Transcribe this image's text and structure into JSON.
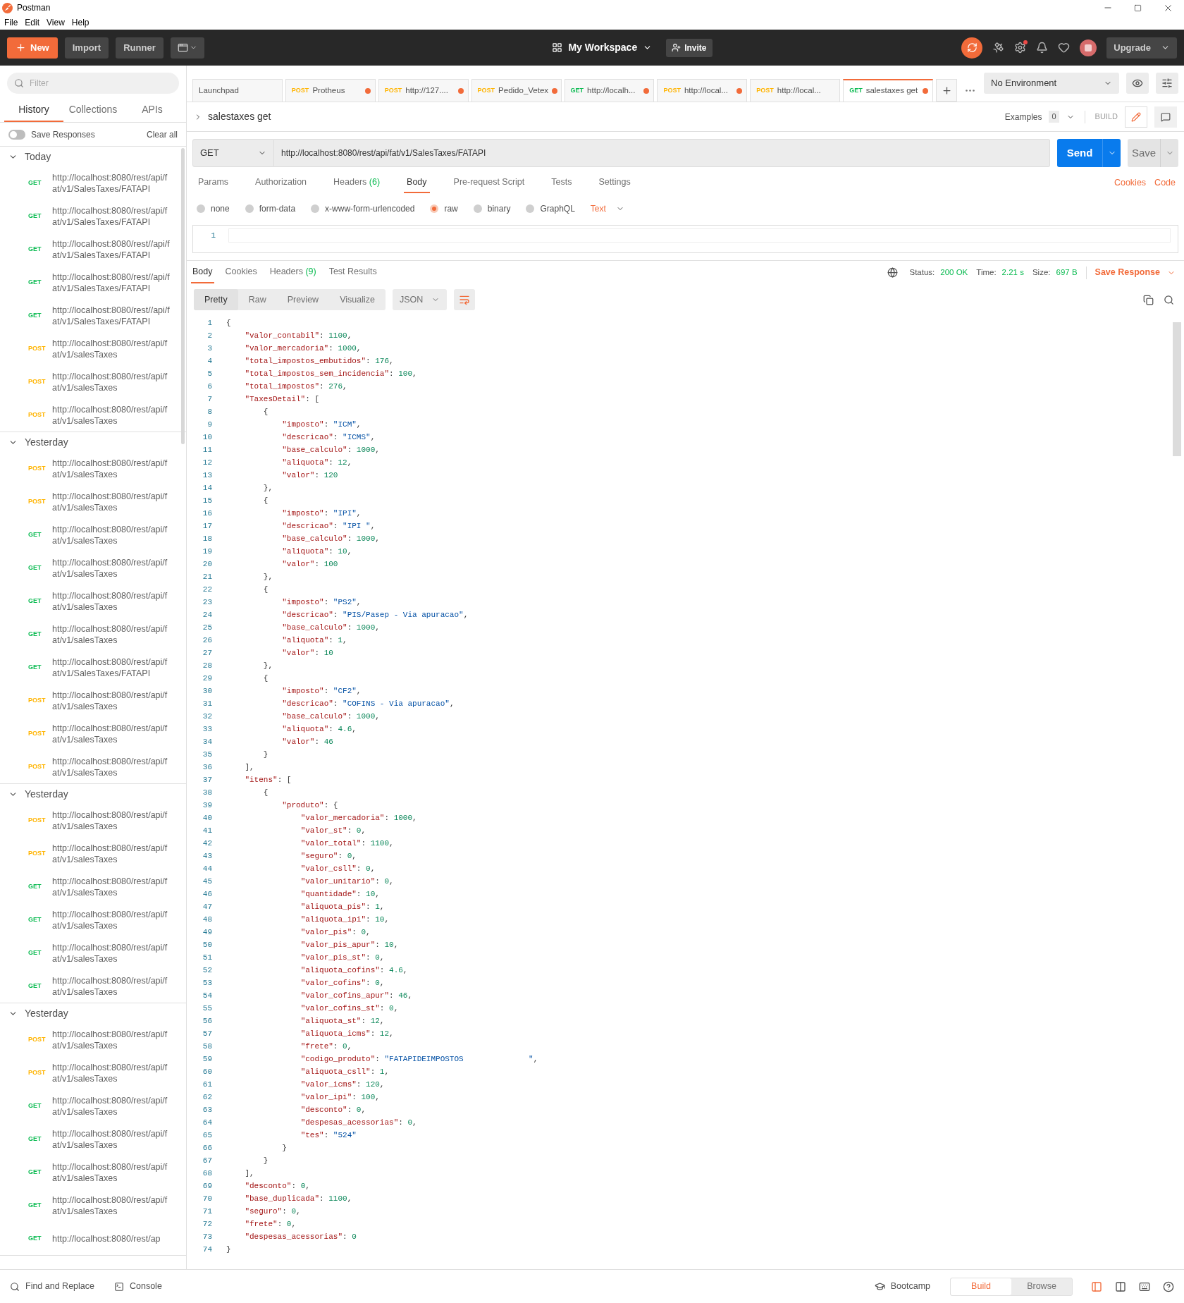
{
  "window": {
    "title": "Postman",
    "menu": [
      "File",
      "Edit",
      "View",
      "Help"
    ]
  },
  "header": {
    "new_button": "New",
    "import_button": "Import",
    "runner_button": "Runner",
    "workspace": "My Workspace",
    "invite_button": "Invite",
    "upgrade_button": "Upgrade"
  },
  "sidebar": {
    "filter_placeholder": "Filter",
    "tabs": [
      {
        "label": "History",
        "selected": true
      },
      {
        "label": "Collections",
        "selected": false
      },
      {
        "label": "APIs",
        "selected": false
      }
    ],
    "save_responses": {
      "label": "Save Responses",
      "on": false
    },
    "clear_all": "Clear all",
    "groups": [
      {
        "title": "Today",
        "expanded": true,
        "items": [
          {
            "method": "GET",
            "url": "http://localhost:8080/rest/api/fat/v1/SalesTaxes/FATAPI"
          },
          {
            "method": "GET",
            "url": "http://localhost:8080/rest/api/fat/v1/SalesTaxes/FATAPI"
          },
          {
            "method": "GET",
            "url": "http://localhost:8080/rest//api/fat/v1/SalesTaxes/FATAPI"
          },
          {
            "method": "GET",
            "url": "http://localhost:8080/rest//api/fat/v1/SalesTaxes/FATAPI"
          },
          {
            "method": "GET",
            "url": "http://localhost:8080/rest//api/fat/v1/SalesTaxes/FATAPI"
          },
          {
            "method": "POST",
            "url": "http://localhost:8080/rest/api/fat/v1/salesTaxes"
          },
          {
            "method": "POST",
            "url": "http://localhost:8080/rest/api/fat/v1/salesTaxes"
          },
          {
            "method": "POST",
            "url": "http://localhost:8080/rest/api/fat/v1/salesTaxes"
          }
        ]
      },
      {
        "title": "Yesterday",
        "expanded": true,
        "items": [
          {
            "method": "POST",
            "url": "http://localhost:8080/rest/api/fat/v1/salesTaxes"
          },
          {
            "method": "POST",
            "url": "http://localhost:8080/rest/api/fat/v1/salesTaxes"
          },
          {
            "method": "GET",
            "url": "http://localhost:8080/rest/api/fat/v1/salesTaxes"
          },
          {
            "method": "GET",
            "url": "http://localhost:8080/rest/api/fat/v1/salesTaxes"
          },
          {
            "method": "GET",
            "url": "http://localhost:8080/rest/api/fat/v1/salesTaxes"
          },
          {
            "method": "GET",
            "url": "http://localhost:8080/rest/api/fat/v1/salesTaxes"
          },
          {
            "method": "GET",
            "url": "http://localhost:8080/rest/api/fat/v1/SalesTaxes/FATAPI"
          },
          {
            "method": "POST",
            "url": "http://localhost:8080/rest/api/fat/v1/salesTaxes"
          },
          {
            "method": "POST",
            "url": "http://localhost:8080/rest/api/fat/v1/salesTaxes"
          },
          {
            "method": "POST",
            "url": "http://localhost:8080/rest/api/fat/v1/salesTaxes"
          }
        ]
      },
      {
        "title": "Yesterday",
        "expanded": true,
        "items": [
          {
            "method": "POST",
            "url": "http://localhost:8080/rest/api/fat/v1/salesTaxes"
          },
          {
            "method": "POST",
            "url": "http://localhost:8080/rest/api/fat/v1/salesTaxes"
          },
          {
            "method": "GET",
            "url": "http://localhost:8080/rest/api/fat/v1/salesTaxes"
          },
          {
            "method": "GET",
            "url": "http://localhost:8080/rest/api/fat/v1/salesTaxes"
          },
          {
            "method": "GET",
            "url": "http://localhost:8080/rest/api/fat/v1/salesTaxes"
          },
          {
            "method": "GET",
            "url": "http://localhost:8080/rest/api/fat/v1/salesTaxes"
          }
        ]
      },
      {
        "title": "Yesterday",
        "expanded": true,
        "items": [
          {
            "method": "POST",
            "url": "http://localhost:8080/rest/api/fat/v1/salesTaxes"
          },
          {
            "method": "POST",
            "url": "http://localhost:8080/rest/api/fat/v1/salesTaxes"
          },
          {
            "method": "GET",
            "url": "http://localhost:8080/rest/api/fat/v1/salesTaxes"
          },
          {
            "method": "GET",
            "url": "http://localhost:8080/rest/api/fat/v1/salesTaxes"
          },
          {
            "method": "GET",
            "url": "http://localhost:8080/rest/api/fat/v1/salesTaxes"
          },
          {
            "method": "GET",
            "url": "http://localhost:8080/rest/api/fat/v1/salesTaxes"
          },
          {
            "method": "GET",
            "url": "http://localhost:8080/rest/ap"
          }
        ]
      }
    ]
  },
  "request_tabs": [
    {
      "label": "Launchpad",
      "unsaved": false,
      "selected": false
    },
    {
      "method": "POST",
      "label": "Protheus",
      "unsaved": true,
      "selected": false
    },
    {
      "method": "POST",
      "label": "http://127....",
      "unsaved": true,
      "selected": false
    },
    {
      "method": "POST",
      "label": "Pedido_Vetex",
      "unsaved": true,
      "selected": false
    },
    {
      "method": "GET",
      "label": "http://localh...",
      "unsaved": true,
      "selected": false
    },
    {
      "method": "POST",
      "label": "http://local...",
      "unsaved": true,
      "selected": false
    },
    {
      "method": "POST",
      "label": "http://local...",
      "unsaved": false,
      "selected": false
    },
    {
      "method": "GET",
      "label": "salestaxes get",
      "unsaved": true,
      "selected": true
    }
  ],
  "environment": "No Environment",
  "request": {
    "name": "salestaxes get",
    "examples_label": "Examples",
    "examples_count": "0",
    "build_label": "BUILD",
    "method": "GET",
    "url": "http://localhost:8080/rest/api/fat/v1/SalesTaxes/FATAPI",
    "send_button": "Send",
    "save_button": "Save",
    "tabs": [
      {
        "label": "Params",
        "selected": false
      },
      {
        "label": "Authorization",
        "selected": false
      },
      {
        "label": "Headers",
        "count": "(6)",
        "selected": false
      },
      {
        "label": "Body",
        "selected": true
      },
      {
        "label": "Pre-request Script",
        "selected": false
      },
      {
        "label": "Tests",
        "selected": false
      },
      {
        "label": "Settings",
        "selected": false
      }
    ],
    "links": [
      "Cookies",
      "Code"
    ],
    "body_modes": [
      {
        "label": "none",
        "selected": false
      },
      {
        "label": "form-data",
        "selected": false
      },
      {
        "label": "x-www-form-urlencoded",
        "selected": false
      },
      {
        "label": "raw",
        "selected": true
      },
      {
        "label": "binary",
        "selected": false
      },
      {
        "label": "GraphQL",
        "selected": false
      }
    ],
    "body_format": "Text",
    "editor_line": "1"
  },
  "response": {
    "tabs": [
      {
        "label": "Body",
        "selected": true
      },
      {
        "label": "Cookies",
        "selected": false
      },
      {
        "label": "Headers",
        "count": "(9)",
        "selected": false
      },
      {
        "label": "Test Results",
        "selected": false
      }
    ],
    "status_label": "Status:",
    "status": "200 OK",
    "time_label": "Time:",
    "time": "2.21 s",
    "size_label": "Size:",
    "size": "697 B",
    "save_response": "Save Response",
    "views": [
      {
        "label": "Pretty",
        "selected": true
      },
      {
        "label": "Raw",
        "selected": false
      },
      {
        "label": "Preview",
        "selected": false
      },
      {
        "label": "Visualize",
        "selected": false
      }
    ],
    "format": "JSON",
    "lines": [
      {
        "number": "1",
        "text": "{"
      },
      {
        "number": "2",
        "text": "    \"valor_contabil\": 1100,"
      },
      {
        "number": "3",
        "text": "    \"valor_mercadoria\": 1000,"
      },
      {
        "number": "4",
        "text": "    \"total_impostos_embutidos\": 176,"
      },
      {
        "number": "5",
        "text": "    \"total_impostos_sem_incidencia\": 100,"
      },
      {
        "number": "6",
        "text": "    \"total_impostos\": 276,"
      },
      {
        "number": "7",
        "text": "    \"TaxesDetail\": ["
      },
      {
        "number": "8",
        "text": "        {"
      },
      {
        "number": "9",
        "text": "            \"imposto\": \"ICM\","
      },
      {
        "number": "10",
        "text": "            \"descricao\": \"ICMS\","
      },
      {
        "number": "11",
        "text": "            \"base_calculo\": 1000,"
      },
      {
        "number": "12",
        "text": "            \"aliquota\": 12,"
      },
      {
        "number": "13",
        "text": "            \"valor\": 120"
      },
      {
        "number": "14",
        "text": "        },"
      },
      {
        "number": "15",
        "text": "        {"
      },
      {
        "number": "16",
        "text": "            \"imposto\": \"IPI\","
      },
      {
        "number": "17",
        "text": "            \"descricao\": \"IPI \","
      },
      {
        "number": "18",
        "text": "            \"base_calculo\": 1000,"
      },
      {
        "number": "19",
        "text": "            \"aliquota\": 10,"
      },
      {
        "number": "20",
        "text": "            \"valor\": 100"
      },
      {
        "number": "21",
        "text": "        },"
      },
      {
        "number": "22",
        "text": "        {"
      },
      {
        "number": "23",
        "text": "            \"imposto\": \"PS2\","
      },
      {
        "number": "24",
        "text": "            \"descricao\": \"PIS/Pasep - Via apuracao\","
      },
      {
        "number": "25",
        "text": "            \"base_calculo\": 1000,"
      },
      {
        "number": "26",
        "text": "            \"aliquota\": 1,"
      },
      {
        "number": "27",
        "text": "            \"valor\": 10"
      },
      {
        "number": "28",
        "text": "        },"
      },
      {
        "number": "29",
        "text": "        {"
      },
      {
        "number": "30",
        "text": "            \"imposto\": \"CF2\","
      },
      {
        "number": "31",
        "text": "            \"descricao\": \"COFINS - Via apuracao\","
      },
      {
        "number": "32",
        "text": "            \"base_calculo\": 1000,"
      },
      {
        "number": "33",
        "text": "            \"aliquota\": 4.6,"
      },
      {
        "number": "34",
        "text": "            \"valor\": 46"
      },
      {
        "number": "35",
        "text": "        }"
      },
      {
        "number": "36",
        "text": "    ],"
      },
      {
        "number": "37",
        "text": "    \"itens\": ["
      },
      {
        "number": "38",
        "text": "        {"
      },
      {
        "number": "39",
        "text": "            \"produto\": {"
      },
      {
        "number": "40",
        "text": "                \"valor_mercadoria\": 1000,"
      },
      {
        "number": "41",
        "text": "                \"valor_st\": 0,"
      },
      {
        "number": "42",
        "text": "                \"valor_total\": 1100,"
      },
      {
        "number": "43",
        "text": "                \"seguro\": 0,"
      },
      {
        "number": "44",
        "text": "                \"valor_csll\": 0,"
      },
      {
        "number": "45",
        "text": "                \"valor_unitario\": 0,"
      },
      {
        "number": "46",
        "text": "                \"quantidade\": 10,"
      },
      {
        "number": "47",
        "text": "                \"aliquota_pis\": 1,"
      },
      {
        "number": "48",
        "text": "                \"aliquota_ipi\": 10,"
      },
      {
        "number": "49",
        "text": "                \"valor_pis\": 0,"
      },
      {
        "number": "50",
        "text": "                \"valor_pis_apur\": 10,"
      },
      {
        "number": "51",
        "text": "                \"valor_pis_st\": 0,"
      },
      {
        "number": "52",
        "text": "                \"aliquota_cofins\": 4.6,"
      },
      {
        "number": "53",
        "text": "                \"valor_cofins\": 0,"
      },
      {
        "number": "54",
        "text": "                \"valor_cofins_apur\": 46,"
      },
      {
        "number": "55",
        "text": "                \"valor_cofins_st\": 0,"
      },
      {
        "number": "56",
        "text": "                \"aliquota_st\": 12,"
      },
      {
        "number": "57",
        "text": "                \"aliquota_icms\": 12,"
      },
      {
        "number": "58",
        "text": "                \"frete\": 0,"
      },
      {
        "number": "59",
        "text": "                \"codigo_produto\": \"FATAPIDEIMPOSTOS              \","
      },
      {
        "number": "60",
        "text": "                \"aliquota_csll\": 1,"
      },
      {
        "number": "61",
        "text": "                \"valor_icms\": 120,"
      },
      {
        "number": "62",
        "text": "                \"valor_ipi\": 100,"
      },
      {
        "number": "63",
        "text": "                \"desconto\": 0,"
      },
      {
        "number": "64",
        "text": "                \"despesas_acessorias\": 0,"
      },
      {
        "number": "65",
        "text": "                \"tes\": \"524\""
      },
      {
        "number": "66",
        "text": "            }"
      },
      {
        "number": "67",
        "text": "        }"
      },
      {
        "number": "68",
        "text": "    ],"
      },
      {
        "number": "69",
        "text": "    \"desconto\": 0,"
      },
      {
        "number": "70",
        "text": "    \"base_duplicada\": 1100,"
      },
      {
        "number": "71",
        "text": "    \"seguro\": 0,"
      },
      {
        "number": "72",
        "text": "    \"frete\": 0,"
      },
      {
        "number": "73",
        "text": "    \"despesas_acessorias\": 0"
      },
      {
        "number": "74",
        "text": "}"
      }
    ]
  },
  "bottom_bar": {
    "find_replace": "Find and Replace",
    "console": "Console",
    "bootcamp": "Bootcamp",
    "modes": [
      {
        "label": "Build",
        "selected": true
      },
      {
        "label": "Browse",
        "selected": false
      }
    ]
  }
}
